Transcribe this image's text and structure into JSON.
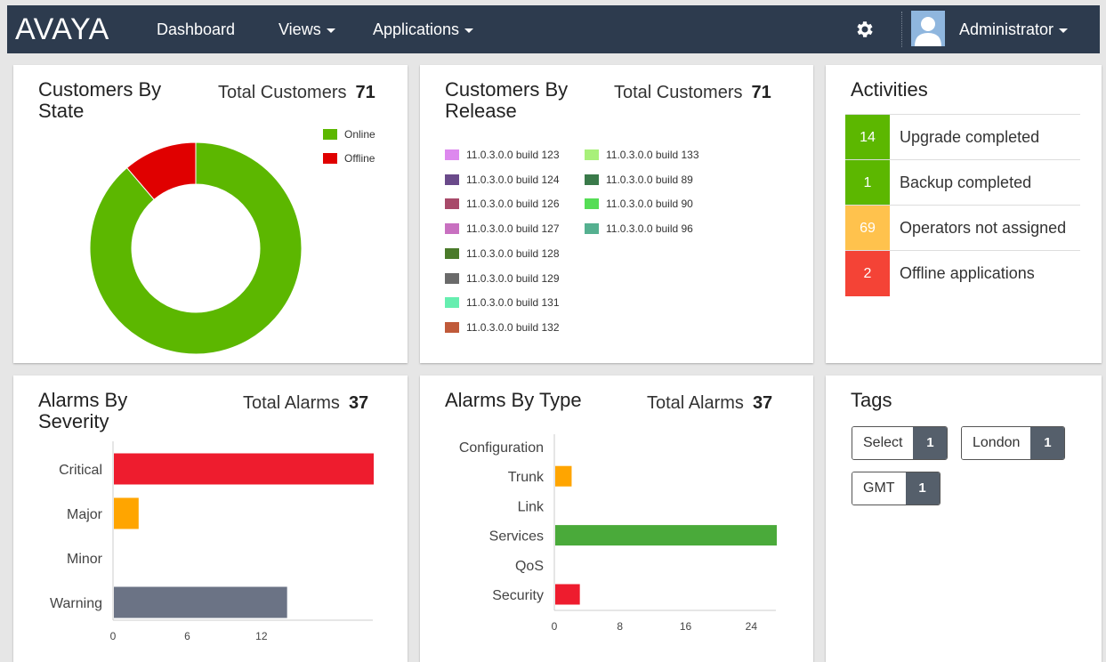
{
  "nav": {
    "brand": "AVAYA",
    "items": [
      "Dashboard",
      "Views",
      "Applications"
    ],
    "user": "Administrator"
  },
  "colors": {
    "nav_bg": "#2d3b4e",
    "online": "#5cb700",
    "offline": "#e00000",
    "green": "#5cb700",
    "orange": "#ffc24d",
    "red": "#f44336"
  },
  "customers_by_state": {
    "title": "Customers By State",
    "total_label": "Total Customers",
    "total": "71",
    "legend": [
      {
        "name": "Online",
        "color": "#5cb700"
      },
      {
        "name": "Offline",
        "color": "#e00000"
      }
    ]
  },
  "customers_by_release": {
    "title": "Customers By Release",
    "total_label": "Total Customers",
    "total": "71",
    "legend": [
      {
        "name": "11.0.3.0.0 build 123",
        "color": "#dd88ee"
      },
      {
        "name": "11.0.3.0.0 build 124",
        "color": "#6a4a8a"
      },
      {
        "name": "11.0.3.0.0 build 126",
        "color": "#a84a6a"
      },
      {
        "name": "11.0.3.0.0 build 127",
        "color": "#c870c0"
      },
      {
        "name": "11.0.3.0.0 build 128",
        "color": "#4a7a2a"
      },
      {
        "name": "11.0.3.0.0 build 129",
        "color": "#6a6a6a"
      },
      {
        "name": "11.0.3.0.0 build 131",
        "color": "#66eeb0"
      },
      {
        "name": "11.0.3.0.0 build 132",
        "color": "#c05a3a"
      },
      {
        "name": "11.0.3.0.0 build 133",
        "color": "#a8f07a"
      },
      {
        "name": "11.0.3.0.0 build 89",
        "color": "#3a7a4a"
      },
      {
        "name": "11.0.3.0.0 build 90",
        "color": "#55dd55"
      },
      {
        "name": "11.0.3.0.0 build 96",
        "color": "#55b090"
      }
    ]
  },
  "activities": {
    "title": "Activities",
    "items": [
      {
        "count": "14",
        "label": "Upgrade completed",
        "color": "#5cb700"
      },
      {
        "count": "1",
        "label": "Backup completed",
        "color": "#5cb700"
      },
      {
        "count": "69",
        "label": "Operators not assigned",
        "color": "#ffc24d"
      },
      {
        "count": "2",
        "label": "Offline applications",
        "color": "#f44336"
      }
    ]
  },
  "alarms_by_severity": {
    "title": "Alarms By Severity",
    "total_label": "Total Alarms",
    "total": "37"
  },
  "alarms_by_type": {
    "title": "Alarms By Type",
    "total_label": "Total Alarms",
    "total": "37"
  },
  "tags": {
    "title": "Tags",
    "items": [
      {
        "name": "Select",
        "count": "1"
      },
      {
        "name": "London",
        "count": "1"
      },
      {
        "name": "GMT",
        "count": "1"
      }
    ]
  },
  "chart_data": [
    {
      "type": "pie",
      "categories": [
        "Online",
        "Offline"
      ],
      "values": [
        63,
        8
      ],
      "colors": [
        "#5cb700",
        "#e00000"
      ],
      "donut": true
    },
    {
      "type": "pie",
      "categories": [
        "11.0.3.0.0 build 123",
        "11.0.3.0.0 build 124",
        "11.0.3.0.0 build 126",
        "11.0.3.0.0 build 127",
        "11.0.3.0.0 build 128",
        "11.0.3.0.0 build 129",
        "11.0.3.0.0 build 131",
        "11.0.3.0.0 build 132",
        "11.0.3.0.0 build 133",
        "11.0.3.0.0 build 89",
        "11.0.3.0.0 build 90",
        "11.0.3.0.0 build 96"
      ],
      "values": [],
      "legend_position": "left"
    },
    {
      "type": "bar",
      "orientation": "horizontal",
      "categories": [
        "Critical",
        "Major",
        "Minor",
        "Warning"
      ],
      "values": [
        21,
        2,
        0,
        14
      ],
      "colors": [
        "#ee1c2e",
        "#ffa500",
        "#ffffff",
        "#6b7385"
      ],
      "xticks": [
        "0",
        "6",
        "12"
      ],
      "xlim": [
        0,
        21
      ]
    },
    {
      "type": "bar",
      "orientation": "horizontal",
      "categories": [
        "Configuration",
        "Trunk",
        "Link",
        "Services",
        "QoS",
        "Security"
      ],
      "values": [
        0,
        2,
        0,
        27,
        0,
        3
      ],
      "colors": [
        "#ffffff",
        "#ffa500",
        "#ffffff",
        "#4aaa3a",
        "#ffffff",
        "#ee1c2e"
      ],
      "xticks": [
        "0",
        "8",
        "16",
        "24"
      ],
      "xlim": [
        0,
        27
      ]
    }
  ]
}
